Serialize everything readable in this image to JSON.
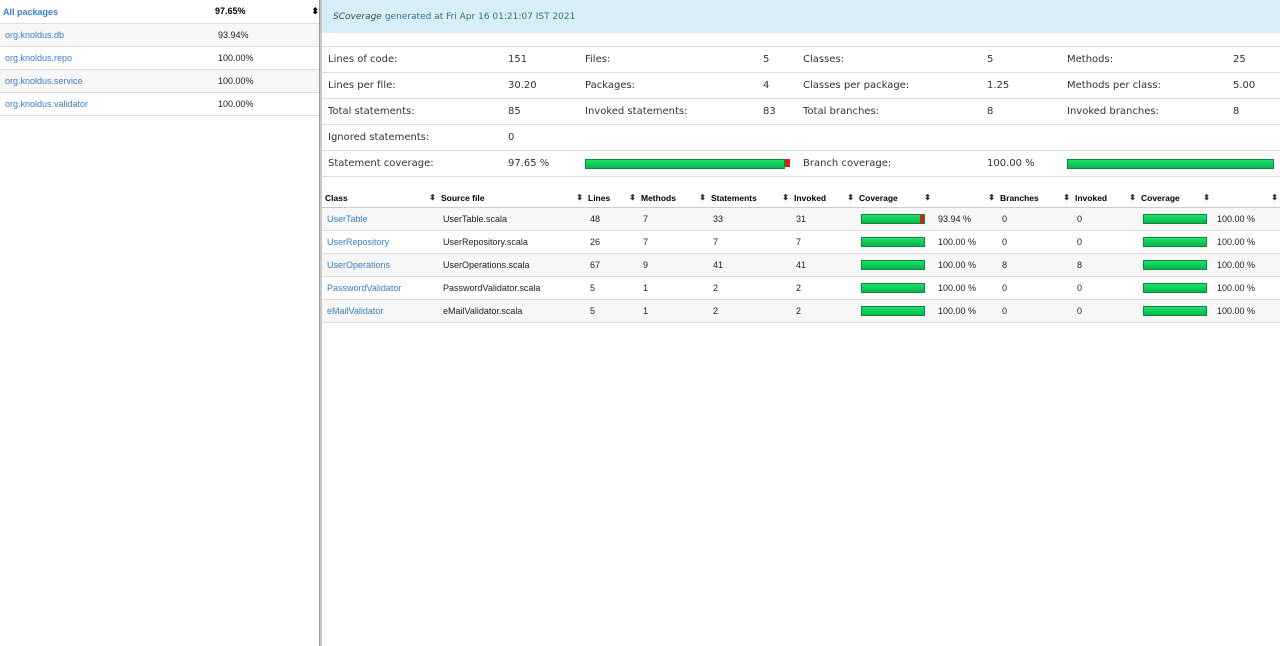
{
  "left": {
    "header": {
      "name": "All packages",
      "pct": "97.65%"
    },
    "packages": [
      {
        "name": "org.knoldus.db",
        "pct": "93.94%"
      },
      {
        "name": "org.knoldus.repo",
        "pct": "100.00%"
      },
      {
        "name": "org.knoldus.service",
        "pct": "100.00%"
      },
      {
        "name": "org.knoldus.validator",
        "pct": "100.00%"
      }
    ]
  },
  "banner": {
    "brand": "SCoverage",
    "text": "generated at Fri Apr 16 01:21:07 IST 2021"
  },
  "stats": {
    "lines_of_code_label": "Lines of code:",
    "lines_of_code": "151",
    "files_label": "Files:",
    "files": "5",
    "classes_label": "Classes:",
    "classes": "5",
    "methods_label": "Methods:",
    "methods": "25",
    "lines_per_file_label": "Lines per file:",
    "lines_per_file": "30.20",
    "packages_label": "Packages:",
    "packages": "4",
    "classes_per_package_label": "Classes per package:",
    "classes_per_package": "1.25",
    "methods_per_class_label": "Methods per class:",
    "methods_per_class": "5.00",
    "total_statements_label": "Total statements:",
    "total_statements": "85",
    "invoked_statements_label": "Invoked statements:",
    "invoked_statements": "83",
    "total_branches_label": "Total branches:",
    "total_branches": "8",
    "invoked_branches_label": "Invoked branches:",
    "invoked_branches": "8",
    "ignored_statements_label": "Ignored statements:",
    "ignored_statements": "0",
    "statement_coverage_label": "Statement coverage:",
    "statement_coverage": "97.65 %",
    "statement_coverage_fraction": 0.9765,
    "branch_coverage_label": "Branch coverage:",
    "branch_coverage": "100.00 %",
    "branch_coverage_fraction": 1.0
  },
  "table": {
    "headers": [
      "Class",
      "Source file",
      "Lines",
      "Methods",
      "Statements",
      "Invoked",
      "Coverage",
      "",
      "Branches",
      "Invoked",
      "Coverage",
      ""
    ],
    "rows": [
      {
        "class": "UserTable",
        "file": "UserTable.scala",
        "lines": "48",
        "methods": "7",
        "statements": "33",
        "invoked": "31",
        "cov": "93.94 %",
        "cov_fraction": 0.9394,
        "branches": "0",
        "binvoked": "0",
        "bcov": "100.00 %",
        "bcov_fraction": 1.0
      },
      {
        "class": "UserRepository",
        "file": "UserRepository.scala",
        "lines": "26",
        "methods": "7",
        "statements": "7",
        "invoked": "7",
        "cov": "100.00 %",
        "cov_fraction": 1.0,
        "branches": "0",
        "binvoked": "0",
        "bcov": "100.00 %",
        "bcov_fraction": 1.0
      },
      {
        "class": "UserOperations",
        "file": "UserOperations.scala",
        "lines": "67",
        "methods": "9",
        "statements": "41",
        "invoked": "41",
        "cov": "100.00 %",
        "cov_fraction": 1.0,
        "branches": "8",
        "binvoked": "8",
        "bcov": "100.00 %",
        "bcov_fraction": 1.0
      },
      {
        "class": "PasswordValidator",
        "file": "PasswordValidator.scala",
        "lines": "5",
        "methods": "1",
        "statements": "2",
        "invoked": "2",
        "cov": "100.00 %",
        "cov_fraction": 1.0,
        "branches": "0",
        "binvoked": "0",
        "bcov": "100.00 %",
        "bcov_fraction": 1.0
      },
      {
        "class": "eMailValidator",
        "file": "eMailValidator.scala",
        "lines": "5",
        "methods": "1",
        "statements": "2",
        "invoked": "2",
        "cov": "100.00 %",
        "cov_fraction": 1.0,
        "branches": "0",
        "binvoked": "0",
        "bcov": "100.00 %",
        "bcov_fraction": 1.0
      }
    ]
  },
  "colors": {
    "covered": "#0fd05a",
    "uncovered": "#d2201d",
    "link": "#3a7dc9",
    "banner_bg": "#d9edf7"
  },
  "icons": {
    "sort": "sort-arrows-icon"
  }
}
